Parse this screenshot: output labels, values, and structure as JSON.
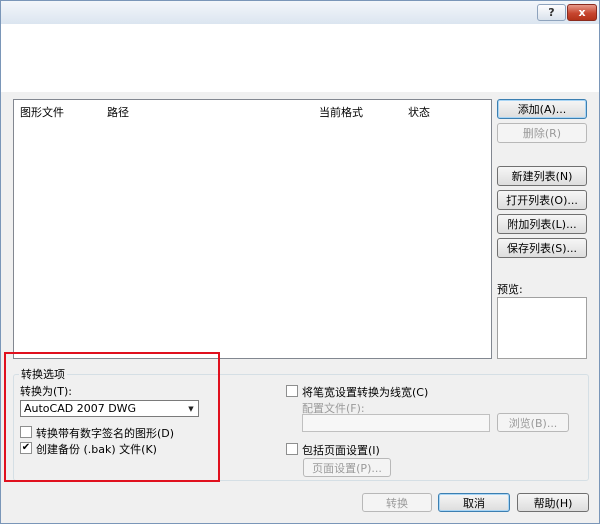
{
  "titlebar": {
    "help_label": "?",
    "close_label": "x"
  },
  "filelist": {
    "columns": [
      "图形文件",
      "路径",
      "当前格式",
      "状态"
    ]
  },
  "side_buttons": {
    "add": "添加(A)...",
    "remove": "删除(R)",
    "new_list": "新建列表(N)",
    "open_list": "打开列表(O)...",
    "append_list": "附加列表(L)...",
    "save_list": "保存列表(S)..."
  },
  "preview_label": "预览:",
  "options": {
    "group_title": "转换选项",
    "convert_to_label": "转换为(T):",
    "convert_to_value": "AutoCAD 2007 DWG",
    "convert_signed_label": "转换带有数字签名的图形(D)",
    "convert_signed_checked": false,
    "create_backup_label": "创建备份 (.bak) 文件(K)",
    "create_backup_checked": true,
    "pen_width_label": "将笔宽设置转换为线宽(C)",
    "pen_width_checked": false,
    "config_file_label": "配置文件(F):",
    "config_file_value": "",
    "browse_label": "浏览(B)...",
    "include_page_setup_label": "包括页面设置(I)",
    "include_page_setup_checked": false,
    "page_setup_label": "页面设置(P)..."
  },
  "footer": {
    "convert": "转换",
    "cancel": "取消",
    "help": "帮助(H)"
  }
}
